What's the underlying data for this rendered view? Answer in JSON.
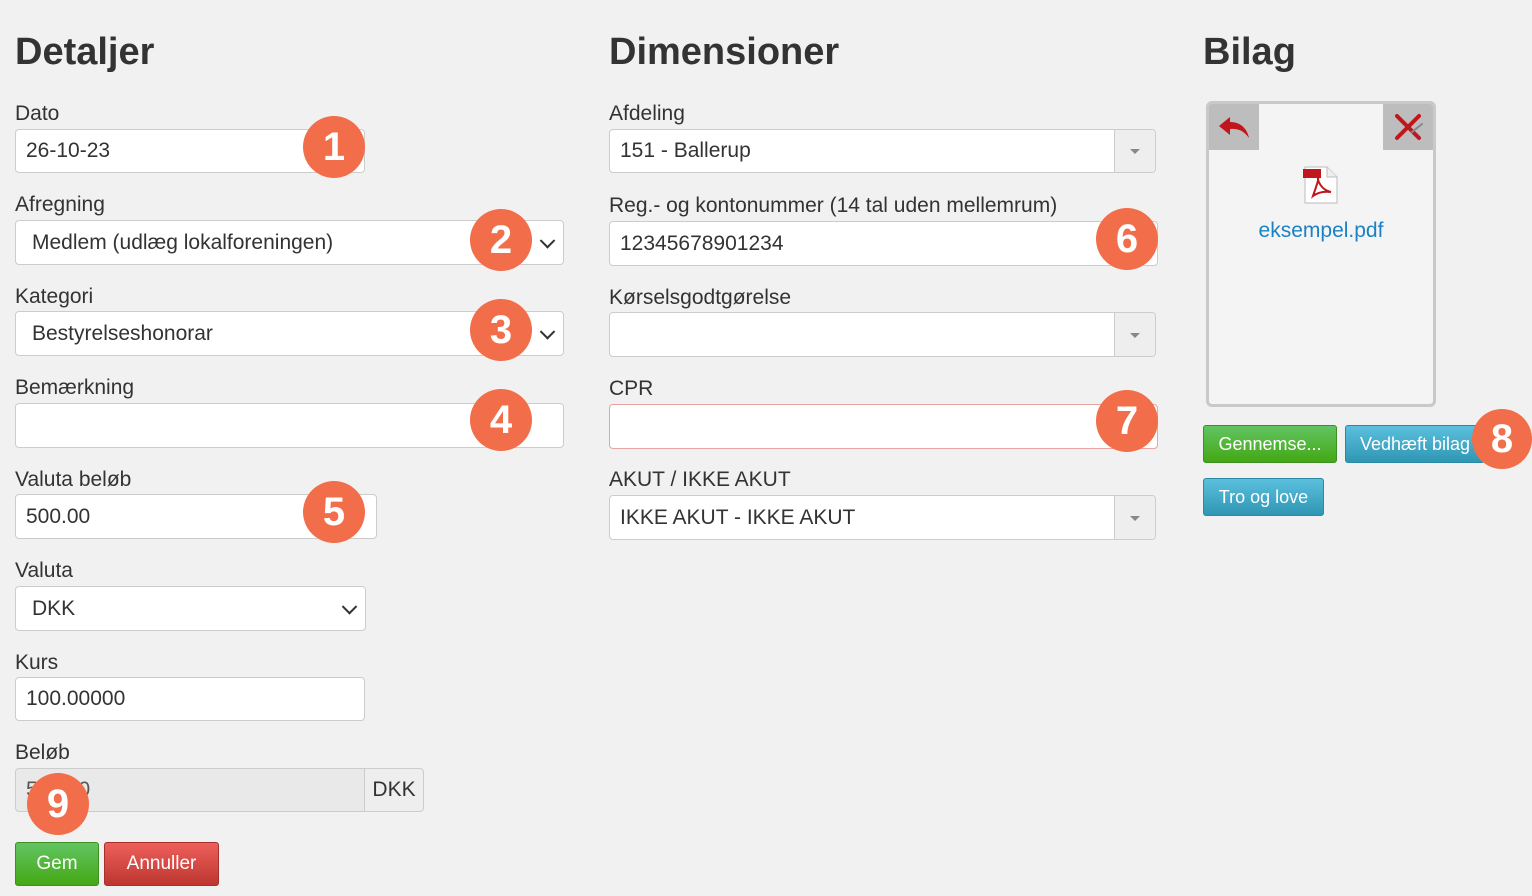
{
  "details": {
    "title": "Detaljer",
    "date": {
      "label": "Dato",
      "value": "26-10-23"
    },
    "settlement": {
      "label": "Afregning",
      "value": "Medlem (udlæg lokalforeningen)"
    },
    "category": {
      "label": "Kategori",
      "value": "Bestyrelseshonorar"
    },
    "remark": {
      "label": "Bemærkning",
      "value": ""
    },
    "currency_amount": {
      "label": "Valuta beløb",
      "value": "500.00"
    },
    "currency": {
      "label": "Valuta",
      "value": "DKK"
    },
    "rate": {
      "label": "Kurs",
      "value": "100.00000"
    },
    "amount": {
      "label": "Beløb",
      "value": "500.00",
      "unit": "DKK"
    }
  },
  "dimensions": {
    "title": "Dimensioner",
    "department": {
      "label": "Afdeling",
      "value": "151 - Ballerup"
    },
    "account": {
      "label": "Reg.- og kontonummer (14 tal uden mellemrum)",
      "value": "12345678901234"
    },
    "mileage": {
      "label": "Kørselsgodtgørelse",
      "value": ""
    },
    "cpr": {
      "label": "CPR",
      "value": ""
    },
    "urgency": {
      "label": "AKUT / IKKE AKUT",
      "value": "IKKE AKUT - IKKE AKUT"
    }
  },
  "attachment": {
    "title": "Bilag",
    "file_name": "eksempel.pdf",
    "browse_label": "Gennemse...",
    "attach_label": "Vedhæft bilag",
    "faith_label": "Tro og love",
    "icons": {
      "undo": "undo-arrow-icon",
      "delete": "delete-x-icon",
      "file": "pdf-file-icon"
    }
  },
  "actions": {
    "save_label": "Gem",
    "cancel_label": "Annuller"
  },
  "markers": [
    "1",
    "2",
    "3",
    "4",
    "5",
    "6",
    "7",
    "8",
    "9"
  ],
  "colors": {
    "marker": "#f26d49",
    "success": "#51a81e",
    "info": "#49afcd",
    "danger": "#da4f49",
    "link": "#1a82c4",
    "invalid_border": "#e8a3a3"
  }
}
